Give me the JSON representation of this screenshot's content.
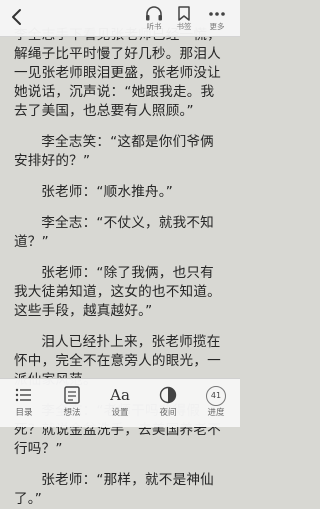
{
  "content": {
    "paragraphs": [
      "李全志手下看见张老师已经一慌，解绳子比平时慢了好几秒。那泪人一见张老师眼泪更盛，张老师没让她说话，沉声说：“她跟我走。我去了美国，也总要有人照顾。”",
      "李全志笑：“这都是你们爷俩安排好的？”",
      "张老师：“顺水推舟。”",
      "李全志：“不仗义，就我不知道？”",
      "张老师：“除了我俩，也只有我大徒弟知道，这女的也不知道。这些手段，越真越好。”",
      "泪人已经扑上来，张老师揽在怀中，完全不在意旁人的眼光，一派仙家风范。",
      "李全志：“老师干吗非得假死？就说金盆洗手，去美国养老不行吗？”",
      "张老师：“那样，就不是神仙了。”"
    ]
  },
  "top_bar": {
    "back_label": "返回",
    "listen": {
      "label": "听书",
      "icon": "headphones-icon"
    },
    "bookmark": {
      "label": "书签",
      "icon": "bookmark-icon"
    },
    "more": {
      "label": "更多",
      "icon": "more-dots-icon"
    }
  },
  "bottom_bar": {
    "items": [
      {
        "label": "目录",
        "icon": "list-icon"
      },
      {
        "label": "想法",
        "icon": "note-icon"
      },
      {
        "label": "设置",
        "icon": "font-settings-icon",
        "glyph": "Aa"
      },
      {
        "label": "夜间",
        "icon": "night-mode-icon"
      },
      {
        "label": "进度",
        "icon": "progress-icon",
        "value": "41"
      }
    ]
  },
  "colors": {
    "page_background": "#d8d8d3",
    "bar_background": "#f5f5f5",
    "text": "#262626"
  }
}
